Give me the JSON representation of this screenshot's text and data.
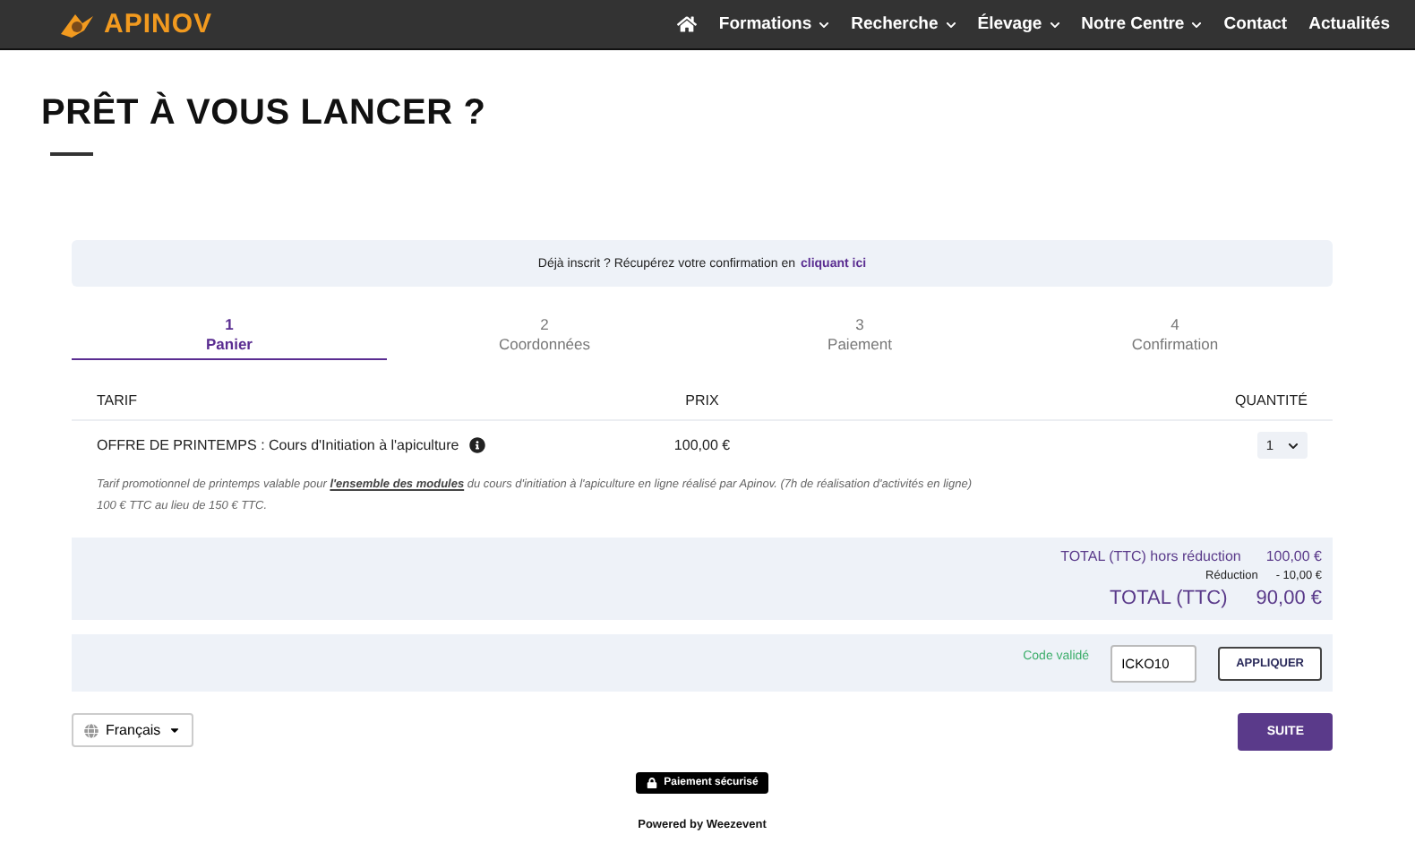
{
  "header": {
    "logo": "APINOV",
    "nav": [
      {
        "kind": "home"
      },
      {
        "kind": "link",
        "label": "Formations",
        "dropdown": true
      },
      {
        "kind": "link",
        "label": "Recherche",
        "dropdown": true
      },
      {
        "kind": "link",
        "label": "Élevage",
        "dropdown": true
      },
      {
        "kind": "link",
        "label": "Notre Centre",
        "dropdown": true
      },
      {
        "kind": "link",
        "label": "Contact",
        "dropdown": false
      },
      {
        "kind": "link",
        "label": "Actualités",
        "dropdown": false
      }
    ]
  },
  "title": "PRÊT À VOUS LANCER ?",
  "notice": {
    "text": "Déjà inscrit ? Récupérez votre confirmation en",
    "link": "cliquant ici"
  },
  "steps": [
    {
      "number": "1",
      "label": "Panier",
      "selected": true
    },
    {
      "number": "2",
      "label": "Coordonnées",
      "selected": false
    },
    {
      "number": "3",
      "label": "Paiement",
      "selected": false
    },
    {
      "number": "4",
      "label": "Confirmation",
      "selected": false
    }
  ],
  "table": {
    "columns": [
      "TARIF",
      "PRIX",
      "QUANTITÉ"
    ],
    "rows": [
      {
        "tarif": "OFFRE DE PRINTEMPS : Cours d'Initiation à l'apiculture",
        "prix": "100,00 €",
        "quantite": "1"
      }
    ],
    "notes": [
      "Tarif promotionnel de printemps valable pour **l'ensemble des modules** du cours d'initiation à l'apiculture en ligne réalisé par Apinov. (7h de réalisation d'activités en ligne)",
      "100 € TTC au lieu de 150 € TTC."
    ]
  },
  "totals": {
    "subtotal_label": "TOTAL (TTC) hors réduction",
    "subtotal": "100,00 €",
    "discount_label": "Réduction",
    "discount": "- 10,00 €",
    "total_label": "TOTAL (TTC)",
    "total": "90,00 €"
  },
  "promo": {
    "status": "Code validé",
    "code": "ICKO10",
    "button": "APPLIQUER"
  },
  "language": "Français",
  "next_button": "SUITE",
  "secure_badge": "Paiement sécurisé",
  "powered_by": "Powered by Weezevent"
}
